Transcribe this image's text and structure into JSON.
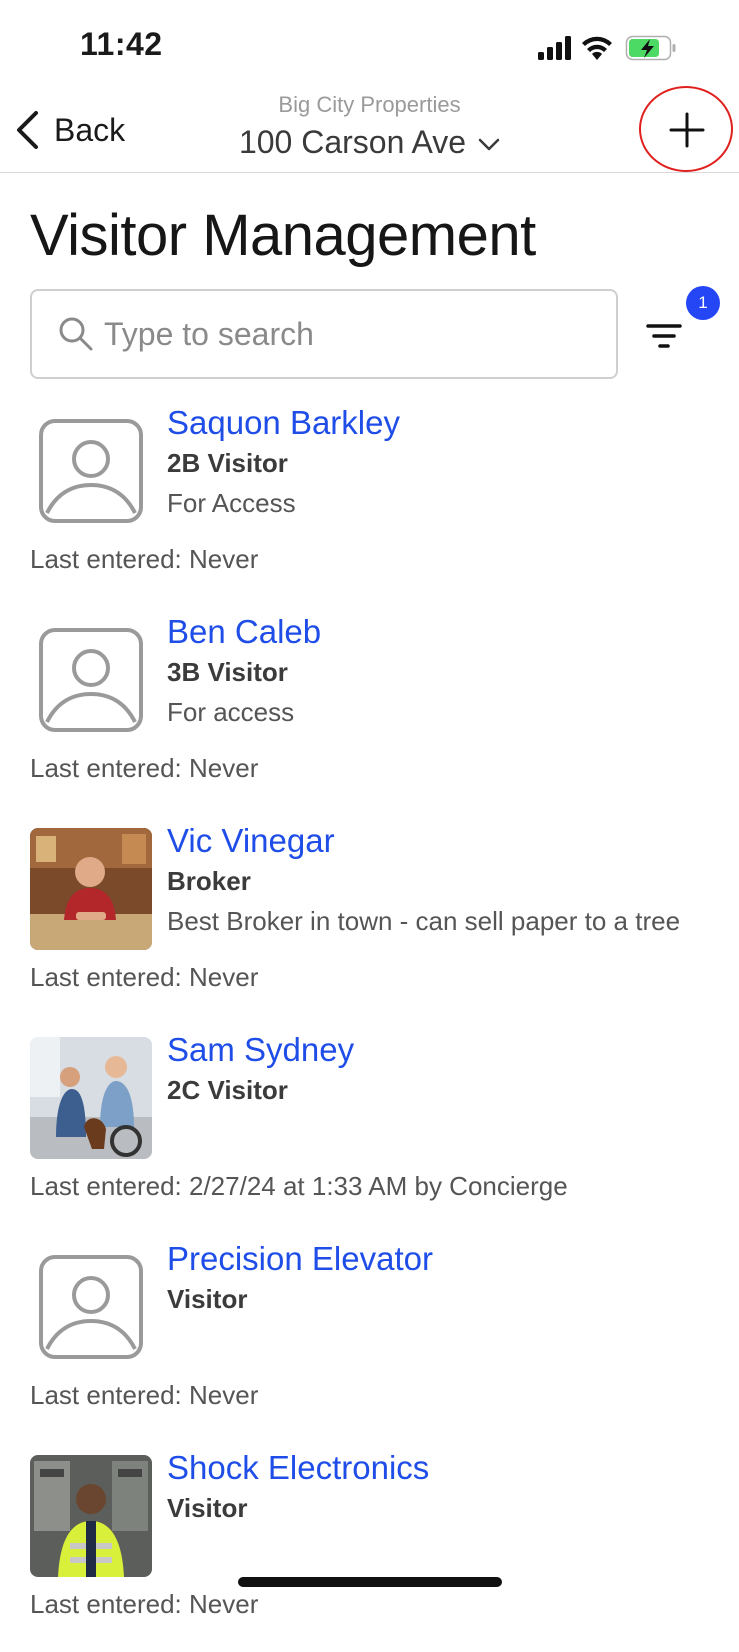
{
  "status_bar": {
    "time": "11:42"
  },
  "nav": {
    "back_label": "Back",
    "org": "Big City Properties",
    "property": "100 Carson Ave"
  },
  "page": {
    "title": "Visitor Management"
  },
  "search": {
    "placeholder": "Type to search",
    "value": ""
  },
  "filter": {
    "badge_count": "1"
  },
  "visitors": [
    {
      "name": "Saquon Barkley",
      "role": "2B Visitor",
      "note": "For Access",
      "last_entered": "Last entered: Never",
      "avatar": "placeholder"
    },
    {
      "name": "Ben Caleb",
      "role": "3B Visitor",
      "note": "For access",
      "last_entered": "Last entered: Never",
      "avatar": "placeholder"
    },
    {
      "name": "Vic Vinegar",
      "role": "Broker",
      "note": "Best Broker in town - can sell paper to a tree",
      "last_entered": "Last entered: Never",
      "avatar": "photo"
    },
    {
      "name": "Sam Sydney",
      "role": "2C Visitor",
      "note": "",
      "last_entered": "Last entered: 2/27/24 at 1:33 AM by Concierge",
      "avatar": "photo"
    },
    {
      "name": "Precision Elevator",
      "role": "Visitor",
      "note": "",
      "last_entered": "Last entered: Never",
      "avatar": "placeholder"
    },
    {
      "name": "Shock Electronics",
      "role": "Visitor",
      "note": "",
      "last_entered": "Last entered: Never",
      "avatar": "photo"
    }
  ],
  "colors": {
    "link": "#1f4de8",
    "badge": "#2446f5",
    "highlight_circle": "#e0201d",
    "battery": "#4cd964"
  }
}
